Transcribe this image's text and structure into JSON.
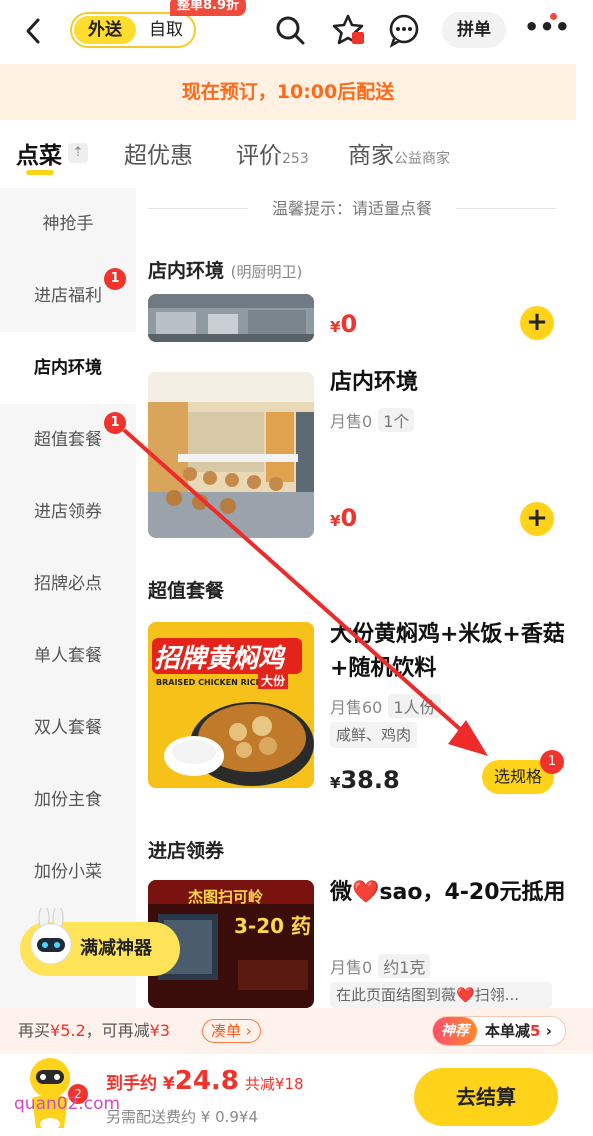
{
  "header": {
    "back_icon": "chevron-left-icon",
    "mode_delivery": "外送",
    "mode_pickup": "自取",
    "discount_badge": "整单8.9折",
    "group_order": "拼单"
  },
  "notice": {
    "preorder": "现在预订，10:00后配送"
  },
  "tabs": {
    "order": "点菜",
    "deals": "超优惠",
    "reviews": "评价",
    "reviews_count": "253",
    "merchant": "商家",
    "merchant_sub": "公益商家"
  },
  "sidebar": {
    "items": [
      "神抢手",
      "进店福利",
      "店内环境",
      "超值套餐",
      "进店领券",
      "招牌必点",
      "单人套餐",
      "双人套餐",
      "加份主食",
      "加份小菜"
    ],
    "badge_fuli": "1",
    "badge_taocan": "1"
  },
  "content": {
    "tip": "温馨提示：请适量点餐",
    "section_env": "店内环境",
    "section_env_sub": "(明厨明卫)",
    "item1_price": "0",
    "item2_name": "店内环境",
    "item2_sales": "月售0",
    "item2_spec": "1个",
    "item2_price": "0",
    "section_combo": "超值套餐",
    "combo_img_title": "招牌黄焖鸡",
    "combo_img_en": "BRAISED CHICKEN RICE",
    "combo_img_tag": "大份",
    "combo_name": "大份黄焖鸡+米饭+香菇+随机饮料",
    "combo_sales": "月售60",
    "combo_spec": "1人份",
    "combo_tag": "咸鲜、鸡肉",
    "combo_price": "38.8",
    "combo_btn": "选规格",
    "combo_btn_badge": "1",
    "section_coupon": "进店领券",
    "coupon_img_text": "杰图扫可岭",
    "coupon_img_text2": "3-20 药",
    "coupon_name": "微❤️sao，4-20元抵用",
    "coupon_sales": "月售0",
    "coupon_spec": "约1克",
    "coupon_tag": "在此页面结图到薇❤️扫翎...",
    "currency": "¥"
  },
  "fab": {
    "label": "满减神器"
  },
  "promo": {
    "text_a": "再买",
    "amount_a": "¥5.2",
    "text_b": "，可再减",
    "amount_b": "¥3",
    "coudan": "凑单",
    "tag": "神荐",
    "right_text": "本单减",
    "right_amount": "5"
  },
  "checkout": {
    "count": "2",
    "total_prefix": "到手约 ¥",
    "total": "24.8",
    "saved": "共减¥18",
    "delivery": "另需配送费约 ¥ 0.9¥4",
    "button": "去结算",
    "watermark": "quan02.com"
  },
  "colors": {
    "accent": "#ffd31a",
    "red": "#f2332b",
    "orange": "#ff6a1a"
  }
}
